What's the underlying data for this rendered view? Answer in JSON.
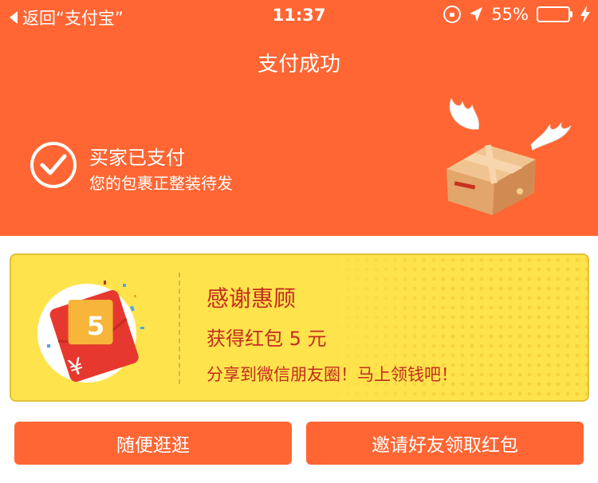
{
  "status_bar": {
    "back_label": "返回“支付宝”",
    "time": "11:37",
    "battery_percent": "55%",
    "battery_level": 0.55,
    "battery_fill_color": "#7be05a"
  },
  "header": {
    "title": "支付成功",
    "paid_title": "买家已支付",
    "paid_subtitle": "您的包裹正整装待发",
    "background_color": "#ff6633"
  },
  "reward_card": {
    "envelope_amount": "5",
    "yen_symbol": "¥",
    "title": "感谢惠顾",
    "amount_text": "获得红包 5 元",
    "share_text": "分享到微信朋友圈！马上领钱吧！",
    "background_color": "#ffe34d",
    "text_color": "#c22d1e"
  },
  "buttons": {
    "browse_label": "随便逛逛",
    "invite_label": "邀请好友领取红包"
  }
}
